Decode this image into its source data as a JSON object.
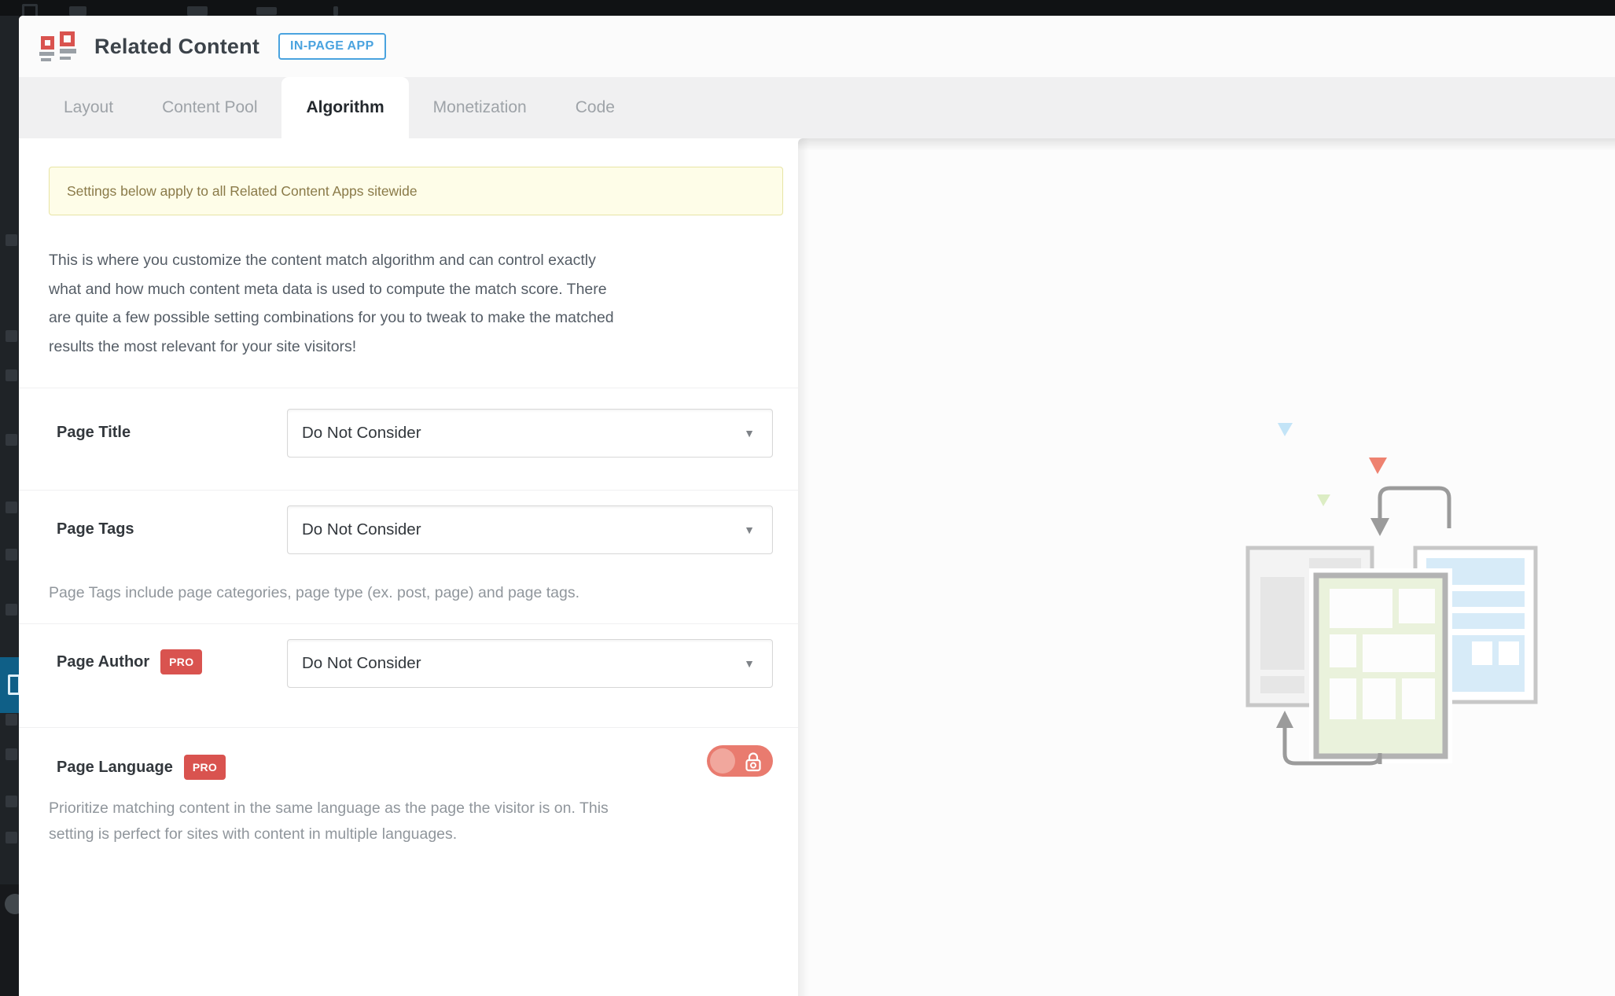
{
  "header": {
    "title": "Related Content",
    "badge": "IN-PAGE APP",
    "logo_icon": "related-content-grid-icon"
  },
  "tabs": [
    {
      "label": "Layout",
      "active": false
    },
    {
      "label": "Content Pool",
      "active": false
    },
    {
      "label": "Algorithm",
      "active": true
    },
    {
      "label": "Monetization",
      "active": false
    },
    {
      "label": "Code",
      "active": false
    }
  ],
  "notice": {
    "text": "Settings below apply to all Related Content Apps sitewide"
  },
  "intro": {
    "text": "This is where you customize the content match algorithm and can control exactly\nwhat and how much content meta data is used to compute the match score. There\nare quite a few possible setting combinations for you to tweak to make the matched\nresults the most relevant for your site visitors!"
  },
  "form": {
    "page_title": {
      "label": "Page Title",
      "value": "Do Not Consider"
    },
    "page_tags": {
      "label": "Page Tags",
      "value": "Do Not Consider",
      "help": "Page Tags include page categories, page type (ex. post, page) and page tags."
    },
    "page_author": {
      "label": "Page Author",
      "badge": "PRO",
      "value": "Do Not Consider"
    },
    "page_language": {
      "label": "Page Language",
      "badge": "PRO",
      "toggle": {
        "state": "off",
        "locked": true
      },
      "help": "Prioritize matching content in the same language as the page the visitor is on. This\nsetting is perfect for sites with content in multiple languages."
    }
  },
  "icons": {
    "dropdown_caret": "▼",
    "toggle_lock": "padlock-outline"
  },
  "colors": {
    "accent_blue": "#4aa3df",
    "pro_red": "#d9534f",
    "toggle_red": "#e97b6f",
    "notice_bg": "#fefde8",
    "notice_border": "#e7e4a5",
    "notice_text": "#8a7a48",
    "sidebar_active_blue": "#0f5f87",
    "tab_bar_bg": "#f0f0f1"
  }
}
